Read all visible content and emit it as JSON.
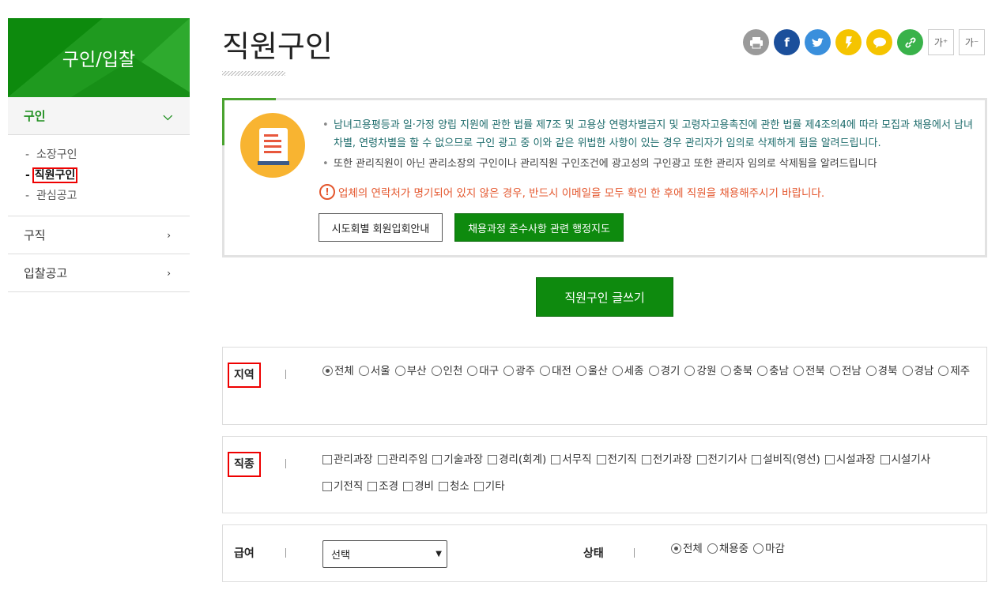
{
  "sidebar": {
    "title": "구인/입찰",
    "active": "구인",
    "sub": [
      "소장구인",
      "직원구인",
      "관심공고"
    ],
    "items": [
      "구직",
      "입찰공고"
    ]
  },
  "page": {
    "title": "직원구인"
  },
  "share": {
    "sq1": "가⁺",
    "sq2": "가⁻"
  },
  "notice": {
    "line1": "남녀고용평등과 일·가정 양립 지원에 관한 법률 제7조 및 고용상 연령차별금지 및 고령자고용촉진에 관한 법률 제4조의4에 따라 모집과 채용에서 남녀차별, 연령차별을 할 수 없으므로 구인 광고 중 이와 같은 위법한 사항이 있는 경우 관리자가 임의로 삭제하게 됨을 알려드립니다.",
    "line2": "또한 관리직원이 아닌 관리소장의 구인이나 관리직원 구인조건에 광고성의 구인광고 또한 관리자 임의로 삭제됨을 알려드립니다",
    "warning": "업체의 연락처가 명기되어 있지 않은 경우, 반드시 이메일을 모두 확인 한 후에 직원을 채용해주시기 바랍니다.",
    "btn1": "시도회별 회원입회안내",
    "btn2": "채용과정 준수사항 관련 행정지도"
  },
  "write_button": "직원구인 글쓰기",
  "region": {
    "label": "지역",
    "options": [
      "전체",
      "서울",
      "부산",
      "인천",
      "대구",
      "광주",
      "대전",
      "울산",
      "세종",
      "경기",
      "강원",
      "충북",
      "충남",
      "전북",
      "전남",
      "경북",
      "경남",
      "제주"
    ]
  },
  "job": {
    "label": "직종",
    "options": [
      "관리과장",
      "관리주임",
      "기술과장",
      "경리(회계)",
      "서무직",
      "전기직",
      "전기과장",
      "전기기사",
      "설비직(영선)",
      "시설과장",
      "시설기사",
      "기전직",
      "조경",
      "경비",
      "청소",
      "기타"
    ]
  },
  "salary": {
    "label": "급여",
    "selected": "선택"
  },
  "status": {
    "label": "상태",
    "options": [
      "전체",
      "채용중",
      "마감"
    ]
  }
}
